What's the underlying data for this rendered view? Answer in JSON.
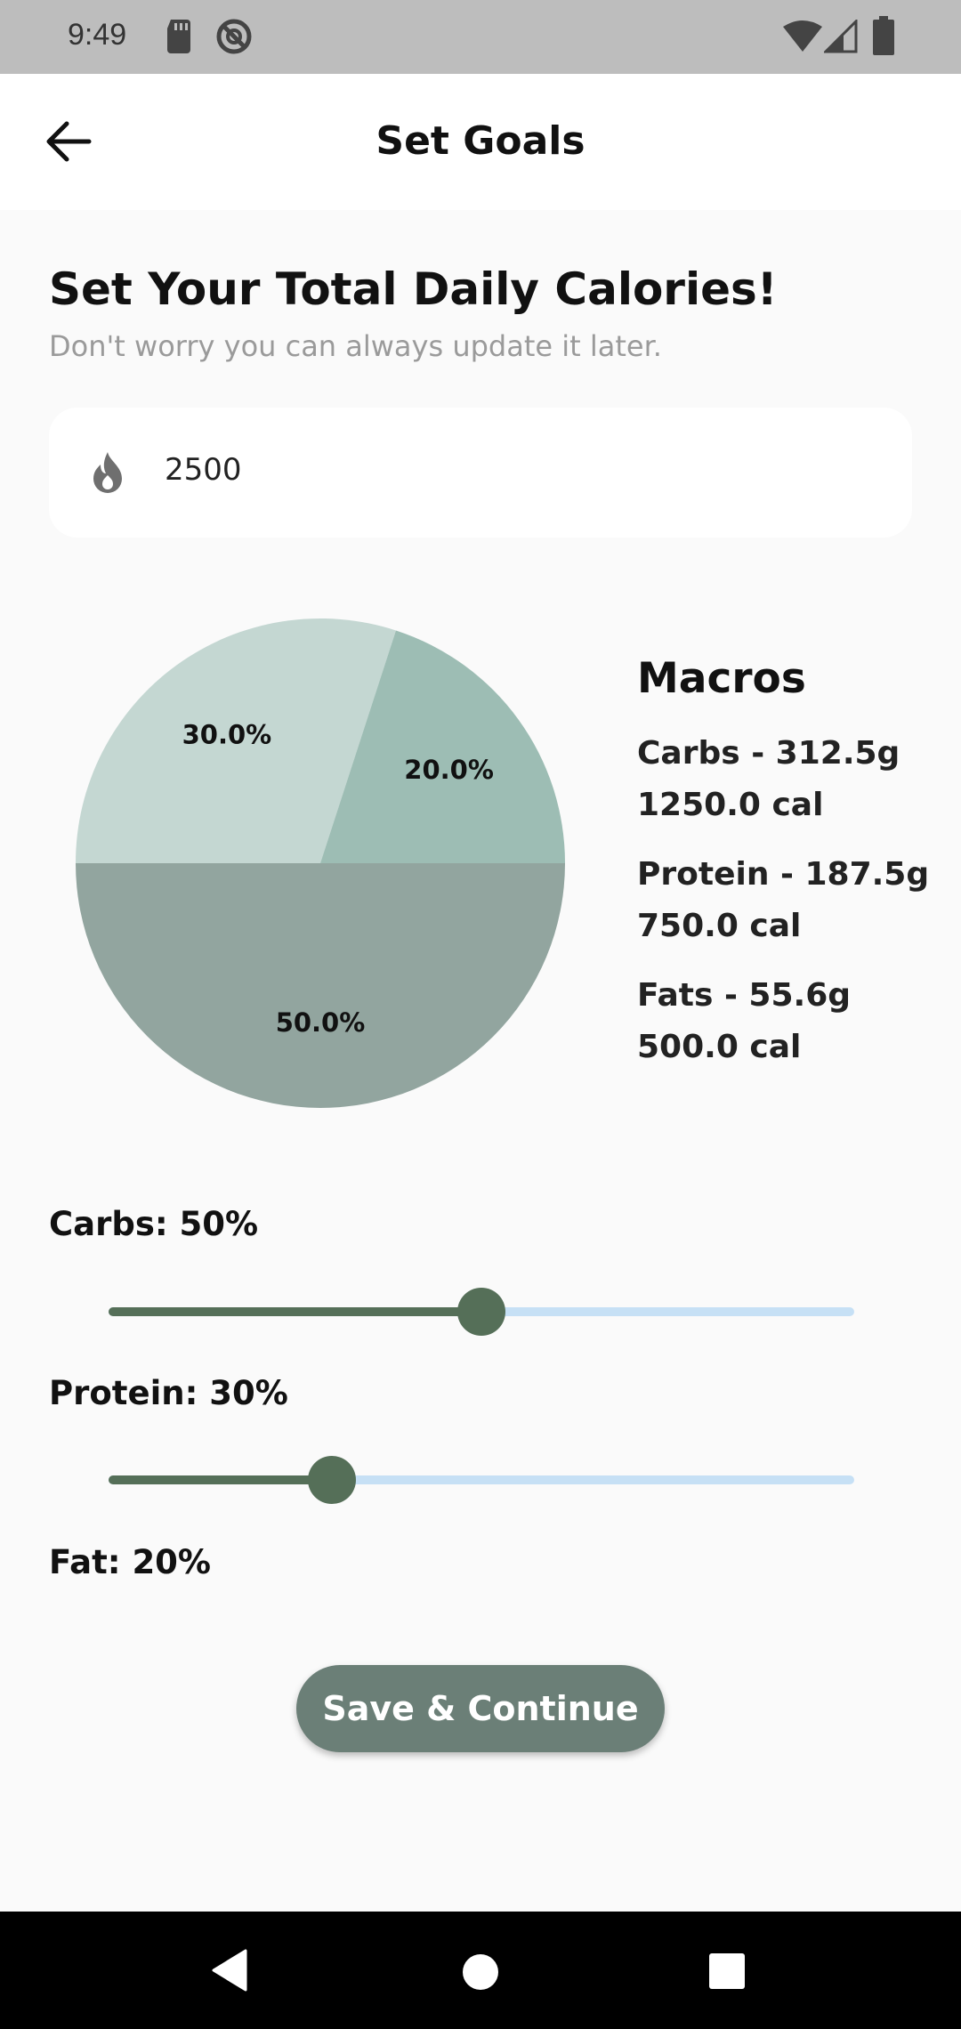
{
  "status_bar": {
    "time": "9:49",
    "icons": [
      "sd-card-icon",
      "do-not-disturb-icon",
      "wifi-icon",
      "signal-icon",
      "battery-icon"
    ]
  },
  "app_bar": {
    "back_icon": "arrow-left-icon",
    "title": "Set Goals"
  },
  "header": {
    "title": "Set Your Total Daily Calories!",
    "subtitle": "Don't worry you can always update it later."
  },
  "calories_input": {
    "icon": "flame-icon",
    "value": "2500"
  },
  "chart_data": {
    "type": "pie",
    "slices": [
      {
        "label": "50.0%",
        "value": 50.0,
        "color": "#92a59f"
      },
      {
        "label": "30.0%",
        "value": 30.0,
        "color": "#c4d7d2"
      },
      {
        "label": "20.0%",
        "value": 20.0,
        "color": "#9dbdb4"
      }
    ]
  },
  "macros": {
    "title": "Macros",
    "items": [
      {
        "line1": "Carbs - 312.5g",
        "line2": "1250.0 cal"
      },
      {
        "line1": "Protein - 187.5g",
        "line2": "750.0 cal"
      },
      {
        "line1": "Fats - 55.6g",
        "line2": "500.0 cal"
      }
    ]
  },
  "sliders": {
    "carbs": {
      "label": "Carbs: 50%",
      "value": 0.5
    },
    "protein": {
      "label": "Protein: 30%",
      "value": 0.3
    }
  },
  "fat_label": "Fat: 20%",
  "save_button": {
    "label": "Save & Continue"
  },
  "colors": {
    "accent": "#556f58",
    "slider_track": "#c6e0f5",
    "button": "#6b7f77"
  },
  "nav_bar": {
    "icons": [
      "back-triangle-icon",
      "home-circle-icon",
      "recents-square-icon"
    ]
  }
}
